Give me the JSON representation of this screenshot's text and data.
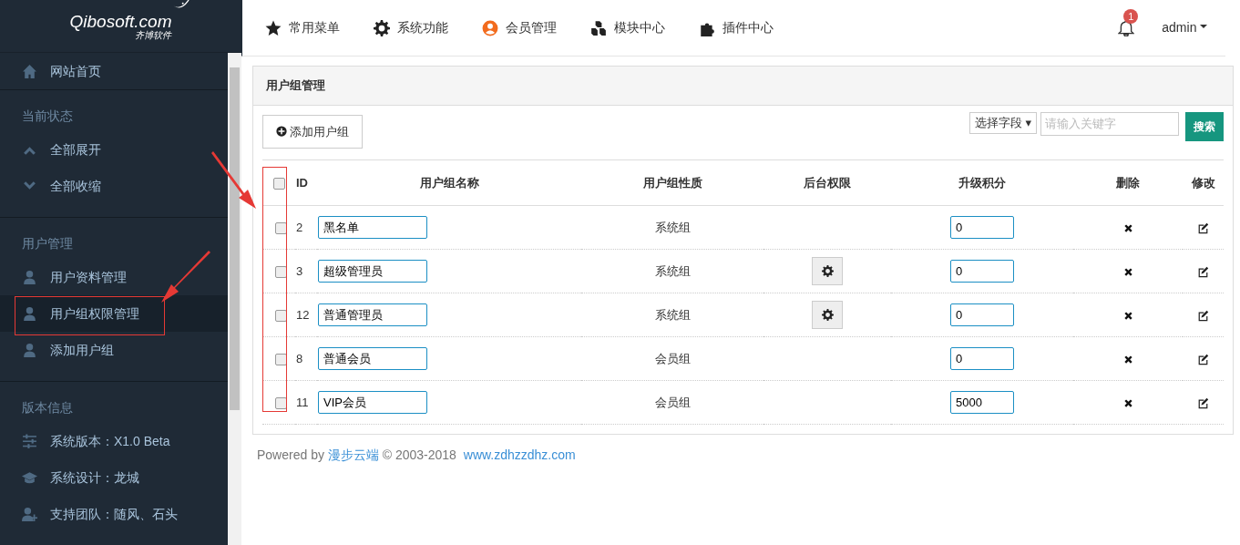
{
  "logo": {
    "text": "Qibosoft",
    "domain": ".com",
    "subtitle": "齐博软件"
  },
  "sidebar": [
    {
      "items": [
        {
          "label": "网站首页",
          "selected": false,
          "highlighted": false
        }
      ]
    },
    {
      "title": "当前状态",
      "items": [
        {
          "label": "全部展开",
          "selected": false,
          "highlighted": false
        },
        {
          "label": "全部收缩",
          "selected": false,
          "highlighted": false
        }
      ]
    },
    {
      "title": "用户管理",
      "items": [
        {
          "label": "用户资料管理",
          "selected": false,
          "highlighted": false
        },
        {
          "label": "用户组权限管理",
          "selected": true,
          "highlighted": true
        },
        {
          "label": "添加用户组",
          "selected": false,
          "highlighted": false
        }
      ]
    },
    {
      "title": "版本信息",
      "items": [
        {
          "label": "系统版本：X1.0 Beta",
          "selected": false,
          "highlighted": false
        },
        {
          "label": "系统设计：龙城",
          "selected": false,
          "highlighted": false
        },
        {
          "label": "支持团队：随风、石头",
          "selected": false,
          "highlighted": false
        }
      ]
    }
  ],
  "topnav": [
    {
      "label": "常用菜单"
    },
    {
      "label": "系统功能"
    },
    {
      "label": "会员管理"
    },
    {
      "label": "模块中心"
    },
    {
      "label": "插件中心"
    }
  ],
  "notifications": "1",
  "user": "admin",
  "panel": {
    "title": "用户组管理",
    "add_button": "添加用户组",
    "field_select": "选择字段 ▾",
    "search_placeholder": "请输入关键字",
    "search_button": "搜索"
  },
  "table": {
    "checkbox_column_highlighted": true,
    "select_all_checked": false,
    "columns": [
      "ID",
      "用户组名称",
      "用户组性质",
      "后台权限",
      "升级积分",
      "删除",
      "修改"
    ],
    "rows": [
      {
        "checked": false,
        "id": "2",
        "name": "黑名单",
        "nature": "系统组",
        "admin_permission": false,
        "points": "0"
      },
      {
        "checked": false,
        "id": "3",
        "name": "超级管理员",
        "nature": "系统组",
        "admin_permission": true,
        "points": "0"
      },
      {
        "checked": false,
        "id": "12",
        "name": "普通管理员",
        "nature": "系统组",
        "admin_permission": true,
        "points": "0"
      },
      {
        "checked": false,
        "id": "8",
        "name": "普通会员",
        "nature": "会员组",
        "admin_permission": false,
        "points": "0"
      },
      {
        "checked": false,
        "id": "11",
        "name": "VIP会员",
        "nature": "会员组",
        "admin_permission": false,
        "points": "5000"
      }
    ]
  },
  "footer": {
    "prefix": "Powered by",
    "brand": "漫步云端",
    "copyright": "© 2003-2018",
    "site": "www.zdhzzdhz.com"
  }
}
